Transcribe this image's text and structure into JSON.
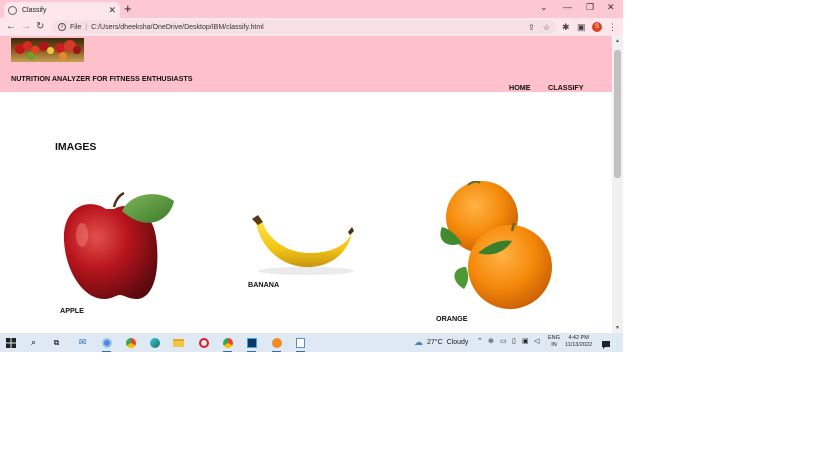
{
  "browser": {
    "tab_title": "Classify",
    "new_tab": "+",
    "url_scheme": "File",
    "url": "C:/Users/dheeksha/OneDrive/Desktop/IBM/classify.html",
    "profile_initial": "S",
    "icons": [
      "back-arrow-icon",
      "forward-arrow-icon",
      "reload-icon",
      "share-icon",
      "star-icon",
      "extensions-icon",
      "sidepanel-icon",
      "menu-icon"
    ]
  },
  "header": {
    "title": "NUTRITION ANALYZER FOR FITNESS ENTHUSIASTS",
    "nav": [
      "HOME",
      "CLASSIFY"
    ]
  },
  "main": {
    "heading": "IMAGES",
    "fruits": [
      {
        "label": "APPLE"
      },
      {
        "label": "BANANA"
      },
      {
        "label": "ORANGE"
      }
    ]
  },
  "taskbar": {
    "weather_temp": "27°C",
    "weather_text": "Cloudy",
    "lang_top": "ENG",
    "lang_bottom": "IN",
    "time": "4:42 PM",
    "date": "11/13/2022"
  }
}
